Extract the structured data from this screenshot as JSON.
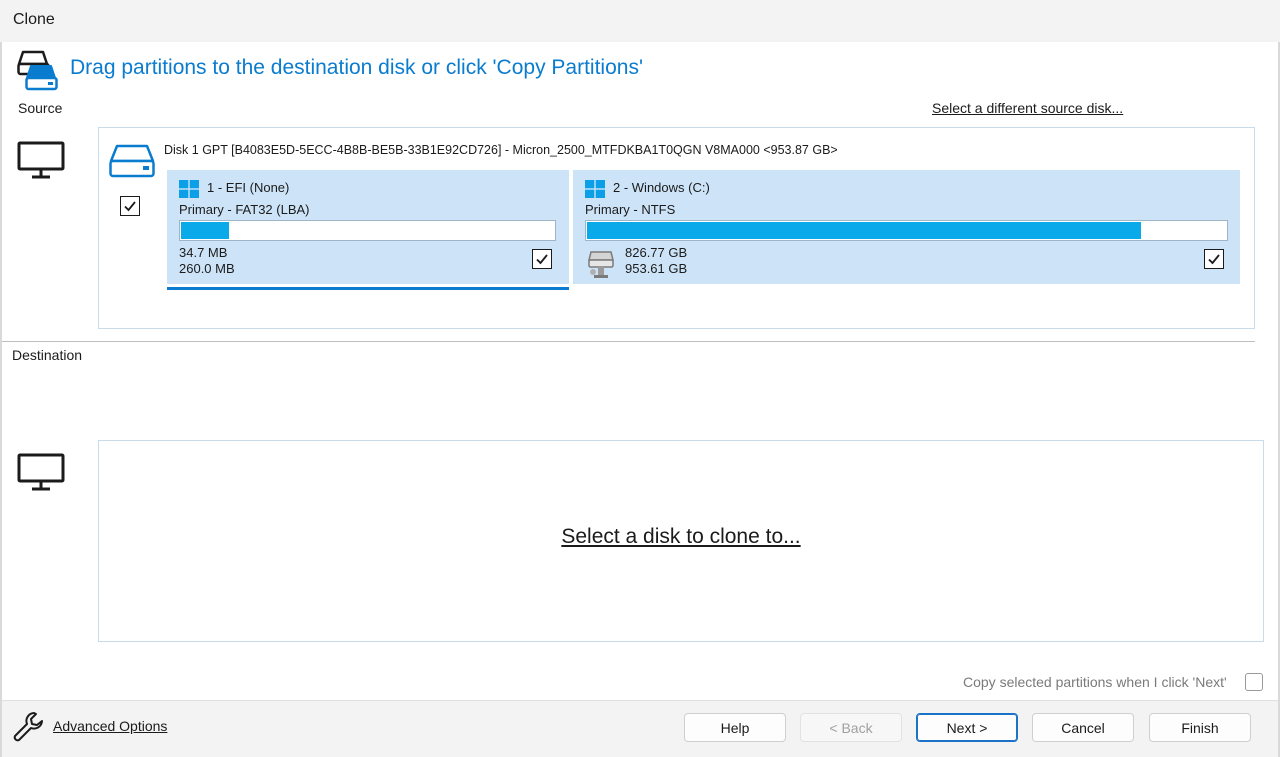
{
  "window": {
    "title": "Clone"
  },
  "header": {
    "instruction": "Drag partitions to the destination disk or click 'Copy Partitions'"
  },
  "source": {
    "label": "Source",
    "change_link": "Select a different source disk...",
    "disk": {
      "label": "Disk 1 GPT [B4083E5D-5ECC-4B8B-BE5B-33B1E92CD726] - Micron_2500_MTFDKBA1T0QGN V8MA000  <953.87 GB>",
      "checked": true
    },
    "partitions": [
      {
        "name": "1 - EFI (None)",
        "type": "Primary - FAT32 (LBA)",
        "used": "34.7 MB",
        "total": "260.0 MB",
        "used_fraction": 0.133,
        "checked": true,
        "selected": true
      },
      {
        "name": "2 - Windows (C:)",
        "type": "Primary - NTFS",
        "used": "826.77 GB",
        "total": "953.61 GB",
        "used_fraction": 0.867,
        "checked": true,
        "selected": false
      }
    ]
  },
  "destination": {
    "label": "Destination",
    "select_link": "Select a disk to clone to..."
  },
  "options": {
    "copy_selected_label": "Copy selected partitions when I click 'Next'",
    "copy_selected_checked": false
  },
  "footer": {
    "advanced_options": "Advanced Options",
    "buttons": {
      "help": "Help",
      "back": "< Back",
      "next": "Next >",
      "cancel": "Cancel",
      "finish": "Finish"
    }
  },
  "colors": {
    "accent": "#0a7ccf",
    "partition_bg": "#cde4f8",
    "usage_fill": "#0aa9e9"
  }
}
